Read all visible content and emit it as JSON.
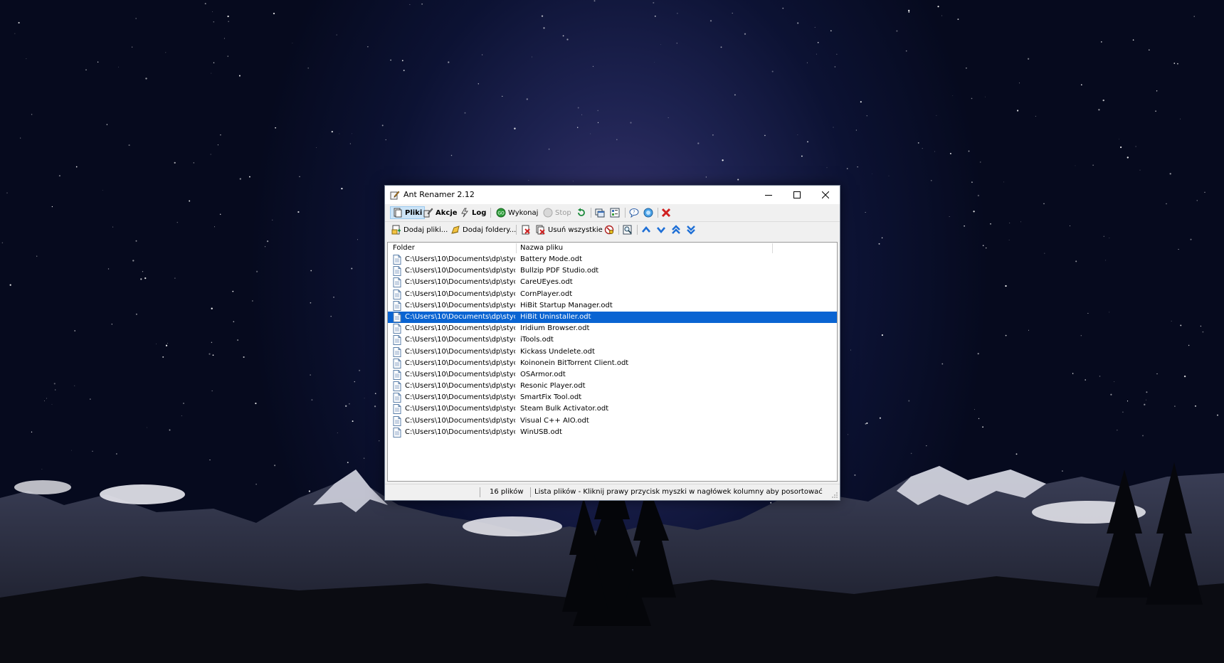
{
  "window": {
    "title": "Ant Renamer 2.12",
    "app_icon": "ant-renamer-icon",
    "controls": [
      "minimize-icon",
      "maximize-icon",
      "close-icon"
    ]
  },
  "toolbar1": {
    "pliki": "Pliki",
    "akcje": "Akcje",
    "log": "Log",
    "wykonaj": "Wykonaj",
    "stop": "Stop",
    "icons": [
      "files-icon",
      "actions-icon",
      "log-icon",
      "go-icon",
      "stop-icon",
      "undo-icon",
      "window-icon",
      "options-icon",
      "help-icon",
      "about-icon",
      "exit-icon"
    ]
  },
  "toolbar2": {
    "add_files": "Dodaj pliki...",
    "add_folders": "Dodaj foldery...",
    "remove_all": "Usuń wszystkie",
    "icons": [
      "add-files-icon",
      "add-folders-icon",
      "remove-selected-icon",
      "remove-all-icon",
      "remove-dead-icon",
      "preview-icon",
      "move-up-icon",
      "move-down-icon",
      "move-top-icon",
      "move-bottom-icon"
    ]
  },
  "list": {
    "columns": [
      "Folder",
      "Nazwa pliku"
    ],
    "selected_index": 5,
    "rows": [
      {
        "folder": "C:\\Users\\10\\Documents\\dp\\styc...",
        "name": "Battery Mode.odt"
      },
      {
        "folder": "C:\\Users\\10\\Documents\\dp\\styc...",
        "name": "Bullzip PDF Studio.odt"
      },
      {
        "folder": "C:\\Users\\10\\Documents\\dp\\styc...",
        "name": "CareUEyes.odt"
      },
      {
        "folder": "C:\\Users\\10\\Documents\\dp\\styc...",
        "name": "CornPlayer.odt"
      },
      {
        "folder": "C:\\Users\\10\\Documents\\dp\\styc...",
        "name": "HiBit Startup Manager.odt"
      },
      {
        "folder": "C:\\Users\\10\\Documents\\dp\\styc...",
        "name": "HiBit Uninstaller.odt"
      },
      {
        "folder": "C:\\Users\\10\\Documents\\dp\\styc...",
        "name": "Iridium Browser.odt"
      },
      {
        "folder": "C:\\Users\\10\\Documents\\dp\\styc...",
        "name": "iTools.odt"
      },
      {
        "folder": "C:\\Users\\10\\Documents\\dp\\styc...",
        "name": "Kickass Undelete.odt"
      },
      {
        "folder": "C:\\Users\\10\\Documents\\dp\\styc...",
        "name": "Koinonein BitTorrent Client.odt"
      },
      {
        "folder": "C:\\Users\\10\\Documents\\dp\\styc...",
        "name": "OSArmor.odt"
      },
      {
        "folder": "C:\\Users\\10\\Documents\\dp\\styc...",
        "name": "Resonic Player.odt"
      },
      {
        "folder": "C:\\Users\\10\\Documents\\dp\\styc...",
        "name": "SmartFix Tool.odt"
      },
      {
        "folder": "C:\\Users\\10\\Documents\\dp\\styc...",
        "name": "Steam Bulk Activator.odt"
      },
      {
        "folder": "C:\\Users\\10\\Documents\\dp\\styc...",
        "name": "Visual C++ AIO.odt"
      },
      {
        "folder": "C:\\Users\\10\\Documents\\dp\\styc...",
        "name": "WinUSB.odt"
      }
    ]
  },
  "statusbar": {
    "count": "16 plików",
    "hint": "Lista plików - Kliknij prawy przycisk myszki w nagłówek kolumny aby posortować"
  },
  "colors": {
    "selection": "#0a64d2",
    "title_bg": "#ffffff",
    "toolbar_bg": "#f0f0f0",
    "arrow_blue": "#1e6fd6"
  }
}
